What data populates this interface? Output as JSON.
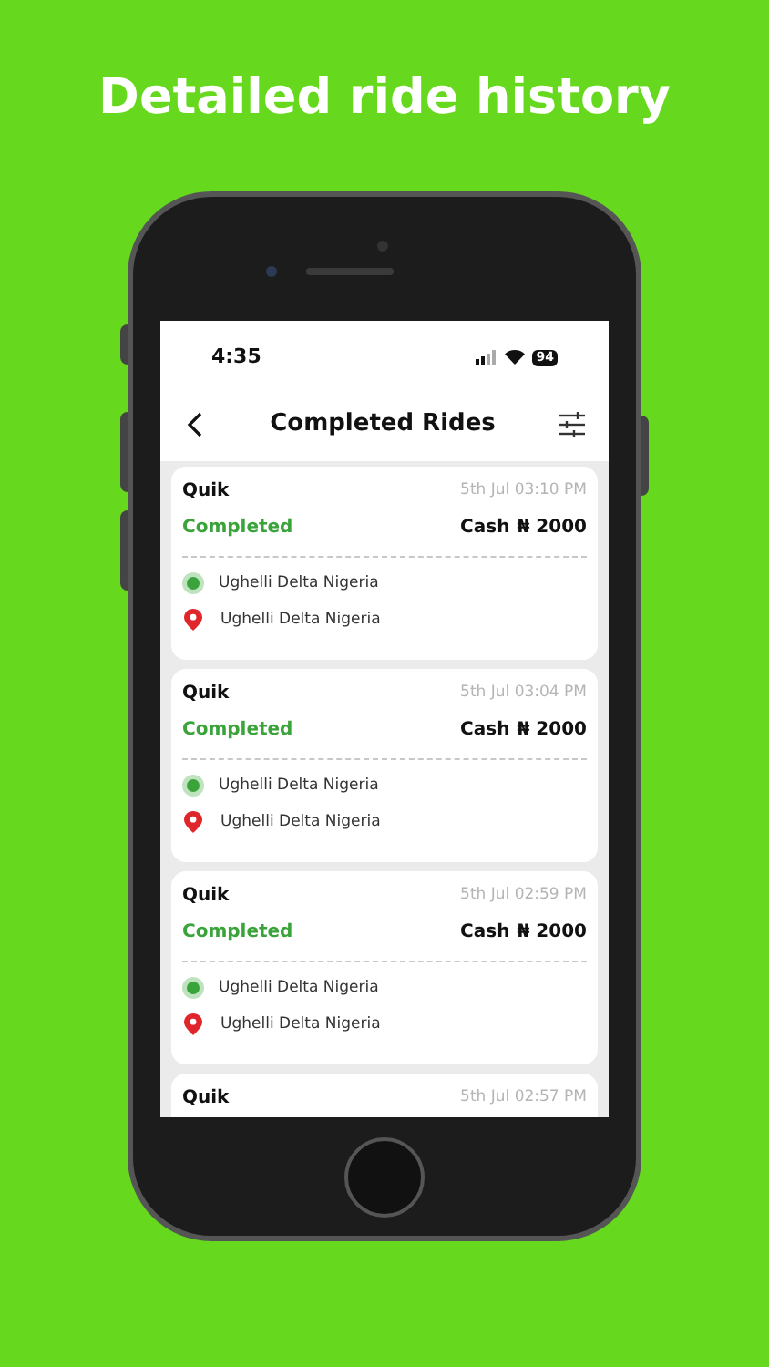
{
  "headline": "Detailed ride history",
  "status_bar": {
    "time": "4:35",
    "battery": "94"
  },
  "header": {
    "title": "Completed Rides"
  },
  "rides": [
    {
      "provider": "Quik",
      "time": "5th Jul 03:10 PM",
      "status": "Completed",
      "payment": "Cash",
      "amount": "₦ 2000",
      "pickup": "Ughelli Delta Nigeria",
      "dropoff": "Ughelli Delta Nigeria"
    },
    {
      "provider": "Quik",
      "time": "5th Jul 03:04 PM",
      "status": "Completed",
      "payment": "Cash",
      "amount": "₦ 2000",
      "pickup": "Ughelli Delta Nigeria",
      "dropoff": "Ughelli Delta Nigeria"
    },
    {
      "provider": "Quik",
      "time": "5th Jul 02:59 PM",
      "status": "Completed",
      "payment": "Cash",
      "amount": "₦ 2000",
      "pickup": "Ughelli Delta Nigeria",
      "dropoff": "Ughelli Delta Nigeria"
    },
    {
      "provider": "Quik",
      "time": "5th Jul 02:57 PM"
    }
  ]
}
